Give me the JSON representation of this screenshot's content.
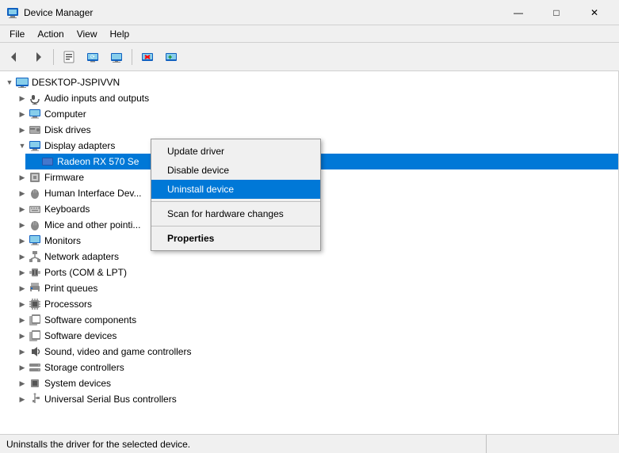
{
  "window": {
    "title": "Device Manager",
    "icon": "🖥"
  },
  "title_controls": {
    "minimize": "—",
    "maximize": "□",
    "close": "✕"
  },
  "menu": {
    "items": [
      "File",
      "Action",
      "View",
      "Help"
    ]
  },
  "toolbar": {
    "buttons": [
      {
        "name": "back",
        "icon": "◀"
      },
      {
        "name": "forward",
        "icon": "▶"
      },
      {
        "name": "properties",
        "icon": "🗒"
      },
      {
        "name": "update-driver",
        "icon": "🔄"
      },
      {
        "name": "scan-hardware",
        "icon": "💻"
      },
      {
        "name": "remove-device",
        "icon": "✖"
      },
      {
        "name": "add-device",
        "icon": "➕"
      }
    ]
  },
  "tree": {
    "root": {
      "label": "DESKTOP-JSPIVVN",
      "icon": "💻",
      "expanded": true
    },
    "items": [
      {
        "label": "Audio inputs and outputs",
        "icon": "🔊",
        "indent": 1,
        "expandable": true
      },
      {
        "label": "Computer",
        "icon": "💻",
        "indent": 1,
        "expandable": true
      },
      {
        "label": "Disk drives",
        "icon": "💾",
        "indent": 1,
        "expandable": true
      },
      {
        "label": "Display adapters",
        "icon": "🖥",
        "indent": 1,
        "expandable": true,
        "expanded": true
      },
      {
        "label": "Radeon RX 570 Se",
        "icon": "▪",
        "indent": 2,
        "selected": true
      },
      {
        "label": "Firmware",
        "icon": "⚙",
        "indent": 1,
        "expandable": true
      },
      {
        "label": "Human Interface Dev...",
        "icon": "🖱",
        "indent": 1,
        "expandable": true
      },
      {
        "label": "Keyboards",
        "icon": "⌨",
        "indent": 1,
        "expandable": true
      },
      {
        "label": "Mice and other pointi...",
        "icon": "🖱",
        "indent": 1,
        "expandable": true
      },
      {
        "label": "Monitors",
        "icon": "🖥",
        "indent": 1,
        "expandable": true
      },
      {
        "label": "Network adapters",
        "icon": "🌐",
        "indent": 1,
        "expandable": true
      },
      {
        "label": "Ports (COM & LPT)",
        "icon": "🔌",
        "indent": 1,
        "expandable": true
      },
      {
        "label": "Print queues",
        "icon": "🖨",
        "indent": 1,
        "expandable": true
      },
      {
        "label": "Processors",
        "icon": "⚙",
        "indent": 1,
        "expandable": true
      },
      {
        "label": "Software components",
        "icon": "📦",
        "indent": 1,
        "expandable": true
      },
      {
        "label": "Software devices",
        "icon": "📦",
        "indent": 1,
        "expandable": true
      },
      {
        "label": "Sound, video and game controllers",
        "icon": "🔊",
        "indent": 1,
        "expandable": true
      },
      {
        "label": "Storage controllers",
        "icon": "💾",
        "indent": 1,
        "expandable": true
      },
      {
        "label": "System devices",
        "icon": "⚙",
        "indent": 1,
        "expandable": true
      },
      {
        "label": "Universal Serial Bus controllers",
        "icon": "🔌",
        "indent": 1,
        "expandable": true
      }
    ]
  },
  "context_menu": {
    "items": [
      {
        "label": "Update driver",
        "type": "normal"
      },
      {
        "label": "Disable device",
        "type": "normal"
      },
      {
        "label": "Uninstall device",
        "type": "active"
      },
      {
        "label": "Scan for hardware changes",
        "type": "normal"
      },
      {
        "label": "Properties",
        "type": "bold"
      }
    ]
  },
  "status_bar": {
    "text": "Uninstalls the driver for the selected device."
  }
}
